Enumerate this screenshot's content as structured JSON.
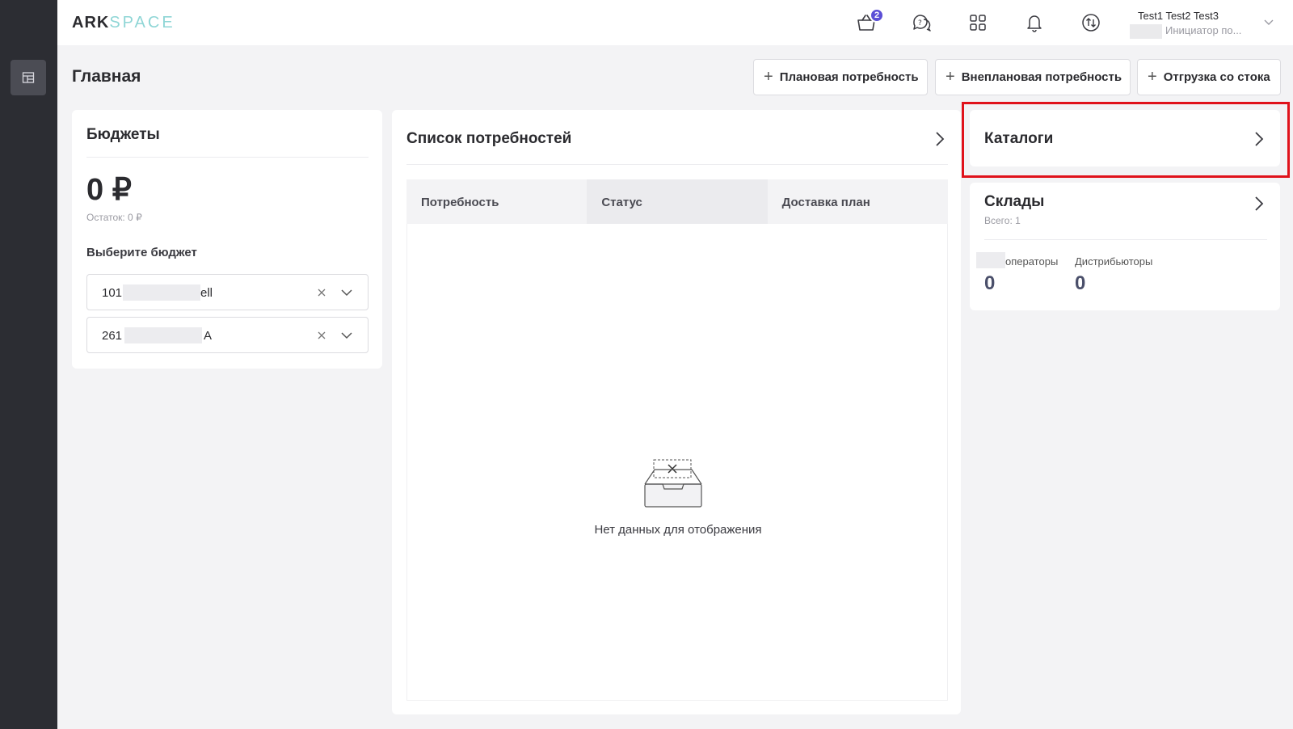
{
  "app": {
    "logo_primary": "ARK",
    "logo_secondary": "SPACE"
  },
  "topbar": {
    "cart_badge": "2",
    "icons": [
      "cart-icon",
      "support-chat-icon",
      "apps-grid-icon",
      "bell-icon",
      "exchange-icon"
    ],
    "user_name": "Test1 Test2 Test3",
    "user_role": "Инициатор по..."
  },
  "page": {
    "title": "Главная",
    "actions": {
      "planned": "Плановая потребность",
      "unplanned": "Внеплановая потребность",
      "stock": "Отгрузка со стока"
    }
  },
  "budgets": {
    "title": "Бюджеты",
    "amount": "0 ₽",
    "remainder": "Остаток: 0 ₽",
    "choose_label": "Выберите бюджет",
    "selects": [
      {
        "prefix": "101",
        "suffix": "ell"
      },
      {
        "prefix": "261",
        "suffix": "A"
      }
    ]
  },
  "needs": {
    "title": "Список потребностей",
    "columns": [
      "Потребность",
      "Статус",
      "Доставка план"
    ],
    "empty_text": "Нет данных для отображения"
  },
  "catalogs": {
    "title": "Каталоги"
  },
  "warehouses": {
    "title": "Склады",
    "subtitle": "Всего: 1",
    "stats": [
      {
        "label": "операторы",
        "value": "0"
      },
      {
        "label": "Дистрибьюторы",
        "value": "0"
      }
    ]
  },
  "colors": {
    "sidebar": "#2c2d33",
    "accent": "#5b4fd6",
    "highlight": "#e0121b"
  }
}
